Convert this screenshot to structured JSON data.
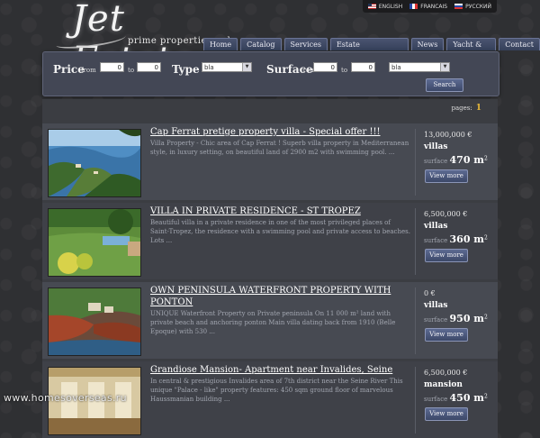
{
  "logo": {
    "name": "Jet Estate",
    "tagline": "prime properties only"
  },
  "languages": [
    {
      "code": "en",
      "label": "ENGLISH"
    },
    {
      "code": "fr",
      "label": "FRANCAIS"
    },
    {
      "code": "ru",
      "label": "РУССКИЙ"
    }
  ],
  "nav": [
    "Home",
    "Catalog",
    "Services",
    "Estate management",
    "News",
    "Yacht & Jet",
    "Contact"
  ],
  "search": {
    "price_label": "Price",
    "from_label": "from",
    "to_label": "to",
    "price_from": "0",
    "price_to": "0",
    "type_label": "Type",
    "type_value": "bla",
    "surface_label": "Surface",
    "surface_from_label": "from",
    "surface_to_label": "to",
    "surface_from": "0",
    "surface_to": "0",
    "extra_value": "bla",
    "button_label": "Search"
  },
  "pagination": {
    "label": "pages:",
    "current": "1"
  },
  "listings": [
    {
      "title": "Cap Ferrat pretige property villa - Special offer !!!",
      "description": "Villa Property - Chic area of Cap Ferrat ! Superb villa property in Mediterranean style, in luxury setting, on beautiful land of 2900 m2 with swimming pool. ...",
      "price": "13,000,000 €",
      "type": "villas",
      "surface_label": "surface",
      "surface": "470 m",
      "button": "View more"
    },
    {
      "title": "VILLA IN PRIVATE RESIDENCE - ST TROPEZ",
      "description": "Beautiful villa in a private residence in one of the most privileged places of Saint-Tropez, the residence with a swimming pool and private access to beaches. Lots ...",
      "price": "6,500,000 €",
      "type": "villas",
      "surface_label": "surface",
      "surface": "360 m",
      "button": "View more"
    },
    {
      "title": "OWN PENINSULA WATERFRONT PROPERTY WITH PONTON",
      "description": "UNIQUE Waterfront Property on Private peninsula On 11 000 m² land with private beach and anchoring ponton Main villa dating back from 1910 (Belle Epoque) with 530 ...",
      "price": "0 €",
      "type": "villas",
      "surface_label": "surface",
      "surface": "950 m",
      "button": "View more"
    },
    {
      "title": "Grandiose Mansion- Apartment near Invalides, Seine",
      "description": "In central & prestigious Invalides area of 7th district near the Seine River This unique \"Palace - like\" property features: 450 sqm ground floor of marvelous Haussmanian building ...",
      "price": "6,500,000 €",
      "type": "mansion",
      "surface_label": "surface",
      "surface": "450 m",
      "button": "View more"
    }
  ],
  "watermark": "www.homesoverseas.ru"
}
